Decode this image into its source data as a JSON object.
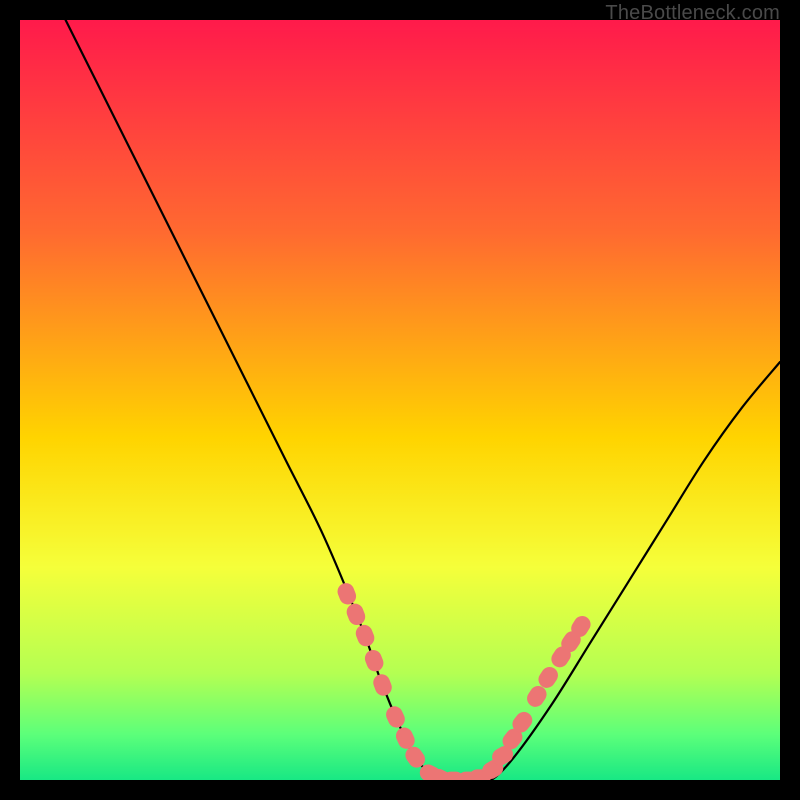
{
  "watermark": "TheBottleneck.com",
  "chart_data": {
    "type": "line",
    "title": "",
    "xlabel": "",
    "ylabel": "",
    "xlim": [
      0,
      100
    ],
    "ylim": [
      0,
      100
    ],
    "grid": false,
    "legend": false,
    "background_gradient": {
      "stops": [
        {
          "pos": 0,
          "color": "#ff1a4b"
        },
        {
          "pos": 28,
          "color": "#ff6a30"
        },
        {
          "pos": 55,
          "color": "#ffd400"
        },
        {
          "pos": 72,
          "color": "#f5ff3a"
        },
        {
          "pos": 86,
          "color": "#b4ff52"
        },
        {
          "pos": 94,
          "color": "#5cff7a"
        },
        {
          "pos": 100,
          "color": "#18e884"
        }
      ]
    },
    "series": [
      {
        "name": "bottleneck-curve",
        "color": "#000000",
        "x": [
          6,
          10,
          15,
          20,
          25,
          30,
          35,
          40,
          45,
          47.5,
          50,
          52,
          55,
          58,
          60,
          62,
          65,
          70,
          75,
          80,
          85,
          90,
          95,
          100
        ],
        "y": [
          100,
          92,
          82,
          72,
          62,
          52,
          42,
          32,
          20,
          13,
          7,
          3,
          0,
          0,
          0,
          0,
          3,
          10,
          18,
          26,
          34,
          42,
          49,
          55
        ]
      }
    ],
    "markers": {
      "name": "highlight-dots",
      "color": "#ec7574",
      "radius_pct": 1.1,
      "points": [
        {
          "x": 43.0,
          "y": 24.5
        },
        {
          "x": 44.2,
          "y": 21.8
        },
        {
          "x": 45.4,
          "y": 19.0
        },
        {
          "x": 46.6,
          "y": 15.7
        },
        {
          "x": 47.7,
          "y": 12.5
        },
        {
          "x": 49.4,
          "y": 8.3
        },
        {
          "x": 50.7,
          "y": 5.5
        },
        {
          "x": 52.0,
          "y": 3.0
        },
        {
          "x": 54.0,
          "y": 0.8
        },
        {
          "x": 55.4,
          "y": 0.2
        },
        {
          "x": 57.0,
          "y": 0.0
        },
        {
          "x": 59.0,
          "y": 0.0
        },
        {
          "x": 60.5,
          "y": 0.3
        },
        {
          "x": 62.2,
          "y": 1.4
        },
        {
          "x": 63.5,
          "y": 3.2
        },
        {
          "x": 64.8,
          "y": 5.4
        },
        {
          "x": 66.1,
          "y": 7.6
        },
        {
          "x": 68.0,
          "y": 11.0
        },
        {
          "x": 69.5,
          "y": 13.5
        },
        {
          "x": 71.2,
          "y": 16.2
        },
        {
          "x": 72.5,
          "y": 18.2
        },
        {
          "x": 73.8,
          "y": 20.2
        }
      ]
    }
  }
}
